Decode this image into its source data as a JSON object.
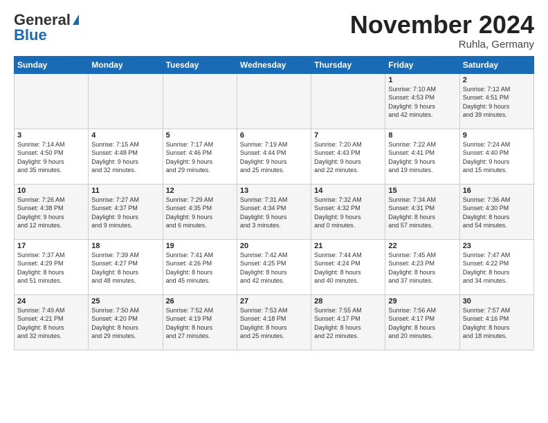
{
  "logo": {
    "general": "General",
    "blue": "Blue"
  },
  "calendar": {
    "title": "November 2024",
    "subtitle": "Ruhla, Germany"
  },
  "headers": [
    "Sunday",
    "Monday",
    "Tuesday",
    "Wednesday",
    "Thursday",
    "Friday",
    "Saturday"
  ],
  "weeks": [
    [
      {
        "day": "",
        "info": ""
      },
      {
        "day": "",
        "info": ""
      },
      {
        "day": "",
        "info": ""
      },
      {
        "day": "",
        "info": ""
      },
      {
        "day": "",
        "info": ""
      },
      {
        "day": "1",
        "info": "Sunrise: 7:10 AM\nSunset: 4:53 PM\nDaylight: 9 hours\nand 42 minutes."
      },
      {
        "day": "2",
        "info": "Sunrise: 7:12 AM\nSunset: 4:51 PM\nDaylight: 9 hours\nand 39 minutes."
      }
    ],
    [
      {
        "day": "3",
        "info": "Sunrise: 7:14 AM\nSunset: 4:50 PM\nDaylight: 9 hours\nand 35 minutes."
      },
      {
        "day": "4",
        "info": "Sunrise: 7:15 AM\nSunset: 4:48 PM\nDaylight: 9 hours\nand 32 minutes."
      },
      {
        "day": "5",
        "info": "Sunrise: 7:17 AM\nSunset: 4:46 PM\nDaylight: 9 hours\nand 29 minutes."
      },
      {
        "day": "6",
        "info": "Sunrise: 7:19 AM\nSunset: 4:44 PM\nDaylight: 9 hours\nand 25 minutes."
      },
      {
        "day": "7",
        "info": "Sunrise: 7:20 AM\nSunset: 4:43 PM\nDaylight: 9 hours\nand 22 minutes."
      },
      {
        "day": "8",
        "info": "Sunrise: 7:22 AM\nSunset: 4:41 PM\nDaylight: 9 hours\nand 19 minutes."
      },
      {
        "day": "9",
        "info": "Sunrise: 7:24 AM\nSunset: 4:40 PM\nDaylight: 9 hours\nand 15 minutes."
      }
    ],
    [
      {
        "day": "10",
        "info": "Sunrise: 7:26 AM\nSunset: 4:38 PM\nDaylight: 9 hours\nand 12 minutes."
      },
      {
        "day": "11",
        "info": "Sunrise: 7:27 AM\nSunset: 4:37 PM\nDaylight: 9 hours\nand 9 minutes."
      },
      {
        "day": "12",
        "info": "Sunrise: 7:29 AM\nSunset: 4:35 PM\nDaylight: 9 hours\nand 6 minutes."
      },
      {
        "day": "13",
        "info": "Sunrise: 7:31 AM\nSunset: 4:34 PM\nDaylight: 9 hours\nand 3 minutes."
      },
      {
        "day": "14",
        "info": "Sunrise: 7:32 AM\nSunset: 4:32 PM\nDaylight: 9 hours\nand 0 minutes."
      },
      {
        "day": "15",
        "info": "Sunrise: 7:34 AM\nSunset: 4:31 PM\nDaylight: 8 hours\nand 57 minutes."
      },
      {
        "day": "16",
        "info": "Sunrise: 7:36 AM\nSunset: 4:30 PM\nDaylight: 8 hours\nand 54 minutes."
      }
    ],
    [
      {
        "day": "17",
        "info": "Sunrise: 7:37 AM\nSunset: 4:29 PM\nDaylight: 8 hours\nand 51 minutes."
      },
      {
        "day": "18",
        "info": "Sunrise: 7:39 AM\nSunset: 4:27 PM\nDaylight: 8 hours\nand 48 minutes."
      },
      {
        "day": "19",
        "info": "Sunrise: 7:41 AM\nSunset: 4:26 PM\nDaylight: 8 hours\nand 45 minutes."
      },
      {
        "day": "20",
        "info": "Sunrise: 7:42 AM\nSunset: 4:25 PM\nDaylight: 8 hours\nand 42 minutes."
      },
      {
        "day": "21",
        "info": "Sunrise: 7:44 AM\nSunset: 4:24 PM\nDaylight: 8 hours\nand 40 minutes."
      },
      {
        "day": "22",
        "info": "Sunrise: 7:45 AM\nSunset: 4:23 PM\nDaylight: 8 hours\nand 37 minutes."
      },
      {
        "day": "23",
        "info": "Sunrise: 7:47 AM\nSunset: 4:22 PM\nDaylight: 8 hours\nand 34 minutes."
      }
    ],
    [
      {
        "day": "24",
        "info": "Sunrise: 7:49 AM\nSunset: 4:21 PM\nDaylight: 8 hours\nand 32 minutes."
      },
      {
        "day": "25",
        "info": "Sunrise: 7:50 AM\nSunset: 4:20 PM\nDaylight: 8 hours\nand 29 minutes."
      },
      {
        "day": "26",
        "info": "Sunrise: 7:52 AM\nSunset: 4:19 PM\nDaylight: 8 hours\nand 27 minutes."
      },
      {
        "day": "27",
        "info": "Sunrise: 7:53 AM\nSunset: 4:18 PM\nDaylight: 8 hours\nand 25 minutes."
      },
      {
        "day": "28",
        "info": "Sunrise: 7:55 AM\nSunset: 4:17 PM\nDaylight: 8 hours\nand 22 minutes."
      },
      {
        "day": "29",
        "info": "Sunrise: 7:56 AM\nSunset: 4:17 PM\nDaylight: 8 hours\nand 20 minutes."
      },
      {
        "day": "30",
        "info": "Sunrise: 7:57 AM\nSunset: 4:16 PM\nDaylight: 8 hours\nand 18 minutes."
      }
    ]
  ]
}
